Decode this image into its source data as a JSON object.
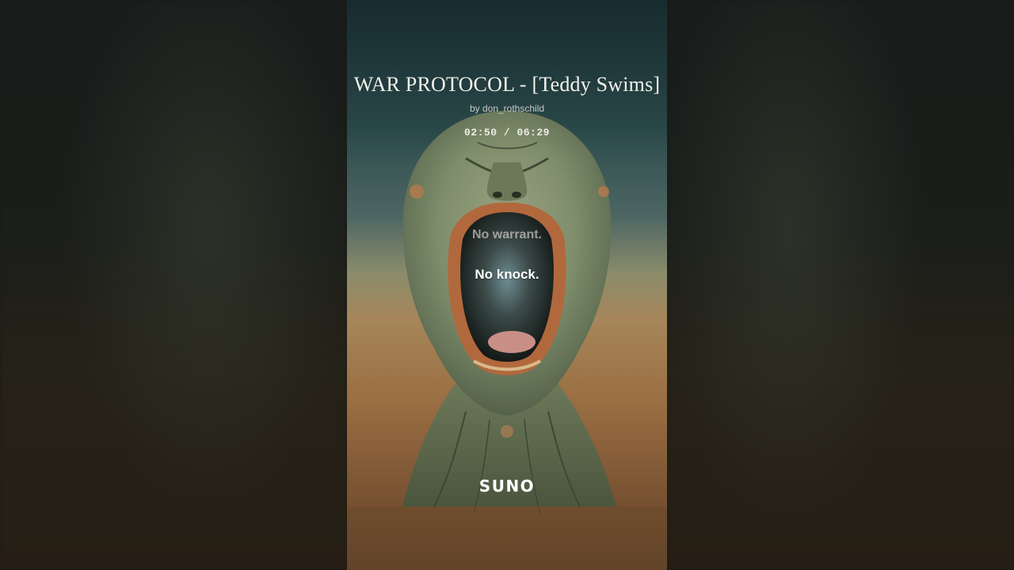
{
  "player": {
    "title": "WAR PROTOCOL - [Teddy Swims]",
    "artist": "by don_rothschild",
    "time": "02:50 / 06:29"
  },
  "lyrics": {
    "previous": "No warrant.",
    "current": "No knock."
  },
  "brand": {
    "logo_text": "SUNO"
  },
  "colors": {
    "sky_top": "#1f3a3f",
    "horizon": "#a6865a",
    "ground": "#5e3f26",
    "face": "#7e8d6b"
  }
}
